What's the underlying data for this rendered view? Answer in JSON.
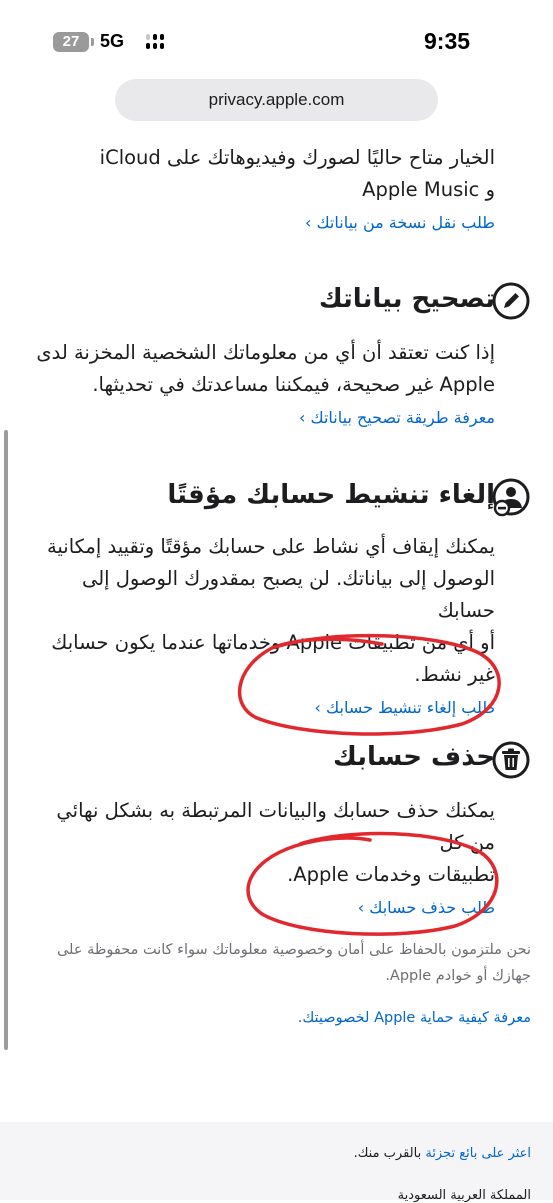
{
  "status_bar": {
    "battery": "27",
    "network": "5G",
    "time": "9:35"
  },
  "browser": {
    "url": "privacy.apple.com"
  },
  "intro": {
    "line1": "الخيار متاح حاليًا لصورك وفيديوهاتك على iCloud",
    "line2": "و Apple Music",
    "link": "طلب نقل نسخة من بياناتك ›"
  },
  "sections": {
    "correct": {
      "icon": "pencil-icon",
      "title": "تصحيح بياناتك",
      "line1": "إذا كنت تعتقد أن أي من معلوماتك الشخصية المخزنة لدى",
      "line2": "Apple غير صحيحة، فيمكننا مساعدتك في تحديثها.",
      "link": "معرفة طريقة تصحيح بياناتك ›"
    },
    "deactivate": {
      "icon": "person-minus-icon",
      "title": "إلغاء تنشيط حسابك مؤقتًا",
      "line1": "يمكنك إيقاف أي نشاط على حسابك مؤقتًا وتقييد إمكانية",
      "line2": "الوصول إلى بياناتك. لن يصبح بمقدورك الوصول إلى حسابك",
      "line3": "أو أي من تطبيقات Apple وخدماتها عندما يكون حسابك",
      "line4": "غير نشط.",
      "link": "طلب إلغاء تنشيط حسابك ›"
    },
    "delete": {
      "icon": "trash-icon",
      "title": "حذف حسابك",
      "line1": "يمكنك حذف حسابك والبيانات المرتبطة به بشكل نهائي من كل",
      "line2": "تطبيقات وخدمات Apple.",
      "link": "طلب حذف حسابك ›"
    }
  },
  "footer": {
    "note_line1": "نحن ملتزمون بالحفاظ على أمان وخصوصية معلوماتك سواء كانت محفوظة على",
    "note_line2": "جهازك أو خوادم Apple.",
    "privacy_link": "معرفة كيفية حماية Apple لخصوصيتك.",
    "store_link": "اعثر على بائع تجزئة",
    "store_suffix": "بالقرب منك.",
    "region": "المملكة العربية السعودية"
  },
  "colors": {
    "link": "#0066cc",
    "annotation": "#e0282e"
  }
}
